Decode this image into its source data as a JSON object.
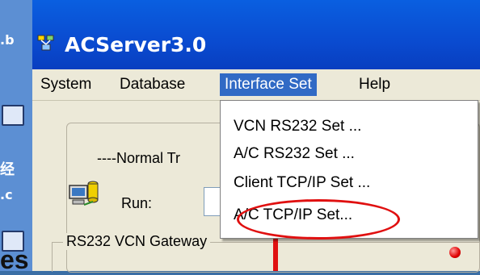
{
  "window": {
    "title": "ACServer3.0"
  },
  "menubar": {
    "items": [
      {
        "label": "System"
      },
      {
        "label": "Database"
      },
      {
        "label": "Interface Set"
      },
      {
        "label": "Help"
      }
    ]
  },
  "dropdown": {
    "items": [
      {
        "label": "VCN RS232 Set ..."
      },
      {
        "label": "A/C RS232 Set ..."
      },
      {
        "label": "Client TCP/IP Set ..."
      },
      {
        "label": "A/C TCP/IP Set..."
      }
    ]
  },
  "main": {
    "normal_label": "----Normal Tr",
    "run_label": "Run:",
    "gateway_label": "RS232 VCN Gateway"
  },
  "desktop": {
    "shortcut_text_1": ".b",
    "shortcut_text_2": "经",
    "shortcut_text_3": ".c",
    "bottom_text": "es"
  },
  "colors": {
    "titlebar": "#0a5fe0",
    "menu_highlight": "#316ac5",
    "annotation": "#e01010"
  }
}
